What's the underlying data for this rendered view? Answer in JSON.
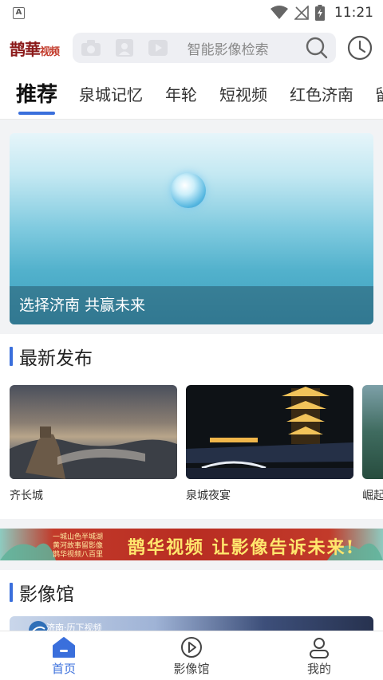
{
  "status": {
    "time": "11:21",
    "notification_letter": "A"
  },
  "header": {
    "logo_main": "鹊華",
    "logo_sub": "视频",
    "search_placeholder": "智能影像检索"
  },
  "tabs": [
    {
      "label": "推荐",
      "active": true
    },
    {
      "label": "泉城记忆",
      "active": false
    },
    {
      "label": "年轮",
      "active": false
    },
    {
      "label": "短视频",
      "active": false
    },
    {
      "label": "红色济南",
      "active": false
    },
    {
      "label": "留",
      "active": false
    }
  ],
  "banner": {
    "caption": "选择济南 共赢未来"
  },
  "latest": {
    "title": "最新发布",
    "cards": [
      {
        "title": "齐长城"
      },
      {
        "title": "泉城夜宴"
      },
      {
        "title": "崛起"
      }
    ]
  },
  "ad": {
    "slogan": "鹊华视频 让影像告诉未来!",
    "small_lines": [
      "一城山色半城湖",
      "黄河故事留影像",
      "鹊华视频八百里"
    ]
  },
  "gallery": {
    "title": "影像馆",
    "thumb_label": "济南·历下视频"
  },
  "bottom_nav": [
    {
      "label": "首页",
      "icon": "home-icon",
      "active": true
    },
    {
      "label": "影像馆",
      "icon": "play-circle-icon",
      "active": false
    },
    {
      "label": "我的",
      "icon": "user-icon",
      "active": false
    }
  ],
  "colors": {
    "accent": "#3a6fdc",
    "brand_red": "#8b1a1a"
  }
}
